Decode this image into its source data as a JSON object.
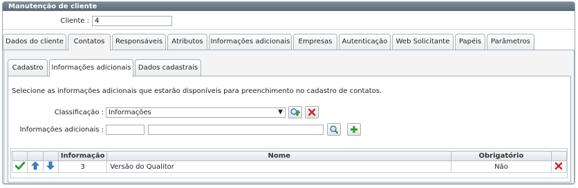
{
  "panel": {
    "title": "Manutenção de cliente"
  },
  "cliente": {
    "label": "Cliente :",
    "value": "4"
  },
  "tabs": [
    {
      "label": "Dados do cliente"
    },
    {
      "label": "Contatos"
    },
    {
      "label": "Responsáveis"
    },
    {
      "label": "Atributos"
    },
    {
      "label": "Informações adicionais"
    },
    {
      "label": "Empresas"
    },
    {
      "label": "Autenticação"
    },
    {
      "label": "Web Solicitante"
    },
    {
      "label": "Papéis"
    },
    {
      "label": "Parâmetros"
    }
  ],
  "active_tab": "Contatos",
  "subtabs": [
    {
      "label": "Cadastro"
    },
    {
      "label": "Informações adicionais"
    },
    {
      "label": "Dados cadastrais"
    }
  ],
  "active_subtab": "Informações adicionais",
  "content": {
    "description": "Selecione as informações adicionais que estarão disponíveis para preenchimento no cadastro de contatos.",
    "classificacao_label": "Classificação :",
    "classificacao_value": "Informações",
    "info_label": "Informações adicionais :"
  },
  "grid": {
    "headers": {
      "informacao": "Informação",
      "nome": "Nome",
      "obrigatorio": "Obrigatório"
    },
    "rows": [
      {
        "informacao": "3",
        "nome": "Versão do Qualitor",
        "obrigatorio": "Não"
      }
    ]
  },
  "colors": {
    "title_bar": "#6b7786",
    "confirm": "#2a9d2a",
    "delete": "#d42020",
    "arrow": "#2b86d6"
  }
}
